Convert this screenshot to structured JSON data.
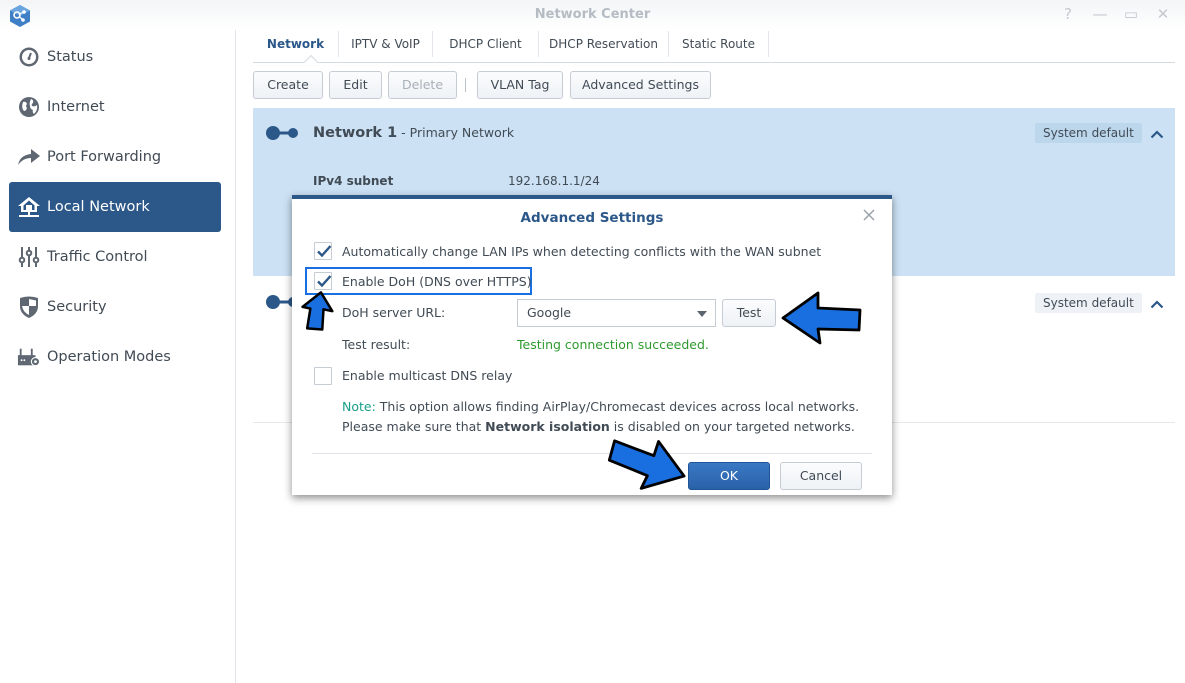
{
  "window": {
    "title": "Network Center",
    "controls": [
      "help-icon",
      "minimize-icon",
      "maximize-icon",
      "close-icon"
    ],
    "help_glyph": "?",
    "minimize_glyph": "—",
    "maximize_glyph": "▭",
    "close_glyph": "✕"
  },
  "sidebar": {
    "items": [
      {
        "label": "Status",
        "icon": "gauge-icon",
        "active": false
      },
      {
        "label": "Internet",
        "icon": "globe-icon",
        "active": false
      },
      {
        "label": "Port Forwarding",
        "icon": "forward-arrow-icon",
        "active": false
      },
      {
        "label": "Local Network",
        "icon": "home-network-icon",
        "active": true
      },
      {
        "label": "Traffic Control",
        "icon": "sliders-icon",
        "active": false
      },
      {
        "label": "Security",
        "icon": "shield-icon",
        "active": false
      },
      {
        "label": "Operation Modes",
        "icon": "router-gear-icon",
        "active": false
      }
    ]
  },
  "tabs": [
    {
      "label": "Network",
      "active": true
    },
    {
      "label": "IPTV & VoIP",
      "active": false
    },
    {
      "label": "DHCP Client",
      "active": false
    },
    {
      "label": "DHCP Reservation",
      "active": false
    },
    {
      "label": "Static Route",
      "active": false
    }
  ],
  "toolbar": {
    "create": "Create",
    "edit": "Edit",
    "delete": "Delete",
    "vlan_tag": "VLAN Tag",
    "advanced_settings": "Advanced Settings"
  },
  "networks": [
    {
      "name": "Network 1",
      "subtitle": " - Primary Network",
      "badge": "System default",
      "fields": [
        {
          "label": "IPv4 subnet",
          "value": "192.168.1.1/24"
        }
      ]
    },
    {
      "badge": "System default"
    }
  ],
  "dialog": {
    "title": "Advanced Settings",
    "auto_change_lan": {
      "label": "Automatically change LAN IPs when detecting conflicts with the WAN subnet",
      "checked": true
    },
    "enable_doh": {
      "label": "Enable DoH (DNS over HTTPS)",
      "checked": true
    },
    "doh_server_label": "DoH server URL:",
    "doh_server_value": "Google",
    "test_button": "Test",
    "test_result_label": "Test result:",
    "test_result_value": "Testing connection succeeded.",
    "multicast_dns": {
      "label": "Enable multicast DNS relay",
      "checked": false
    },
    "note_label": "Note:",
    "note_line1": " This option allows finding AirPlay/Chromecast devices across local networks.",
    "note_line2_pre": "Please make sure that ",
    "note_line2_bold": "Network isolation",
    "note_line2_post": " is disabled on your targeted networks.",
    "ok": "OK",
    "cancel": "Cancel"
  },
  "colors": {
    "accent": "#2b5789",
    "selected_row": "#cce2f4",
    "success": "#2e9a2e",
    "note": "#18a08a",
    "annotation_arrow": "#1a6fe0"
  }
}
